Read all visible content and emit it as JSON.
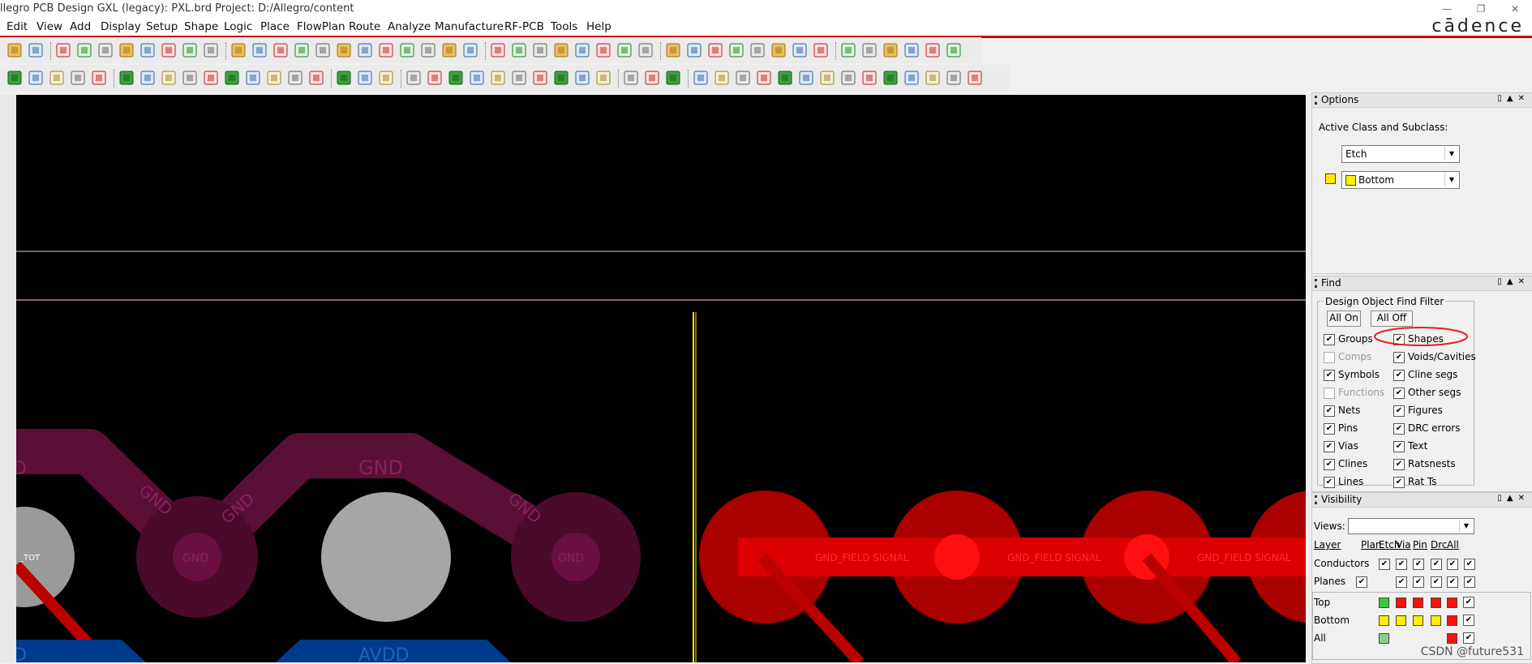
{
  "window": {
    "title": "llegro PCB Design GXL (legacy): PXL.brd  Project: D:/Allegro/content"
  },
  "menu": [
    "Edit",
    "View",
    "Add",
    "Display",
    "Setup",
    "Shape",
    "Logic",
    "Place",
    "FlowPlan",
    "Route",
    "Analyze",
    "Manufacture",
    "RF-PCB",
    "Tools",
    "Help"
  ],
  "brand": "cādence",
  "canvas": {
    "net_labels": [
      "D",
      "GND",
      "GND",
      "GND",
      "GND",
      "_TOT",
      "GND",
      "GND",
      "GND_FIELD SIGNAL",
      "GND_FIELD SIGNAL",
      "GND_FIELD SIGNAL",
      "AVDD",
      "D"
    ]
  },
  "options": {
    "title": "Options",
    "label": "Active Class and Subclass:",
    "class_value": "Etch",
    "subclass_value": "Bottom"
  },
  "find": {
    "title": "Find",
    "group_label": "Design Object Find Filter",
    "all_on": "All On",
    "all_off": "All Off",
    "left": [
      {
        "label": "Groups",
        "checked": "✔"
      },
      {
        "label": "Comps",
        "checked": ""
      },
      {
        "label": "Symbols",
        "checked": "✔"
      },
      {
        "label": "Functions",
        "checked": ""
      },
      {
        "label": "Nets",
        "checked": "✔"
      },
      {
        "label": "Pins",
        "checked": "✔"
      },
      {
        "label": "Vias",
        "checked": "✔"
      },
      {
        "label": "Clines",
        "checked": "✔"
      },
      {
        "label": "Lines",
        "checked": "✔"
      }
    ],
    "right": [
      {
        "label": "Shapes",
        "checked": "✔"
      },
      {
        "label": "Voids/Cavities",
        "checked": "✔"
      },
      {
        "label": "Cline segs",
        "checked": "✔"
      },
      {
        "label": "Other segs",
        "checked": "✔"
      },
      {
        "label": "Figures",
        "checked": "✔"
      },
      {
        "label": "DRC errors",
        "checked": "✔"
      },
      {
        "label": "Text",
        "checked": "✔"
      },
      {
        "label": "Ratsnests",
        "checked": "✔"
      },
      {
        "label": "Rat Ts",
        "checked": "✔"
      }
    ]
  },
  "visibility": {
    "title": "Visibility",
    "views_label": "Views:",
    "views_value": "",
    "columns": [
      "Layer",
      "Plan",
      "Etch",
      "Via",
      "Pin",
      "Drc",
      "All"
    ],
    "rows": [
      "Conductors",
      "Planes",
      "Top",
      "Bottom",
      "All"
    ],
    "check": "✔"
  },
  "colors": {
    "top_color": "#33cc33",
    "bottom_color": "#ffee00",
    "accent": "#cc0000"
  },
  "watermark": "CSDN @future531"
}
